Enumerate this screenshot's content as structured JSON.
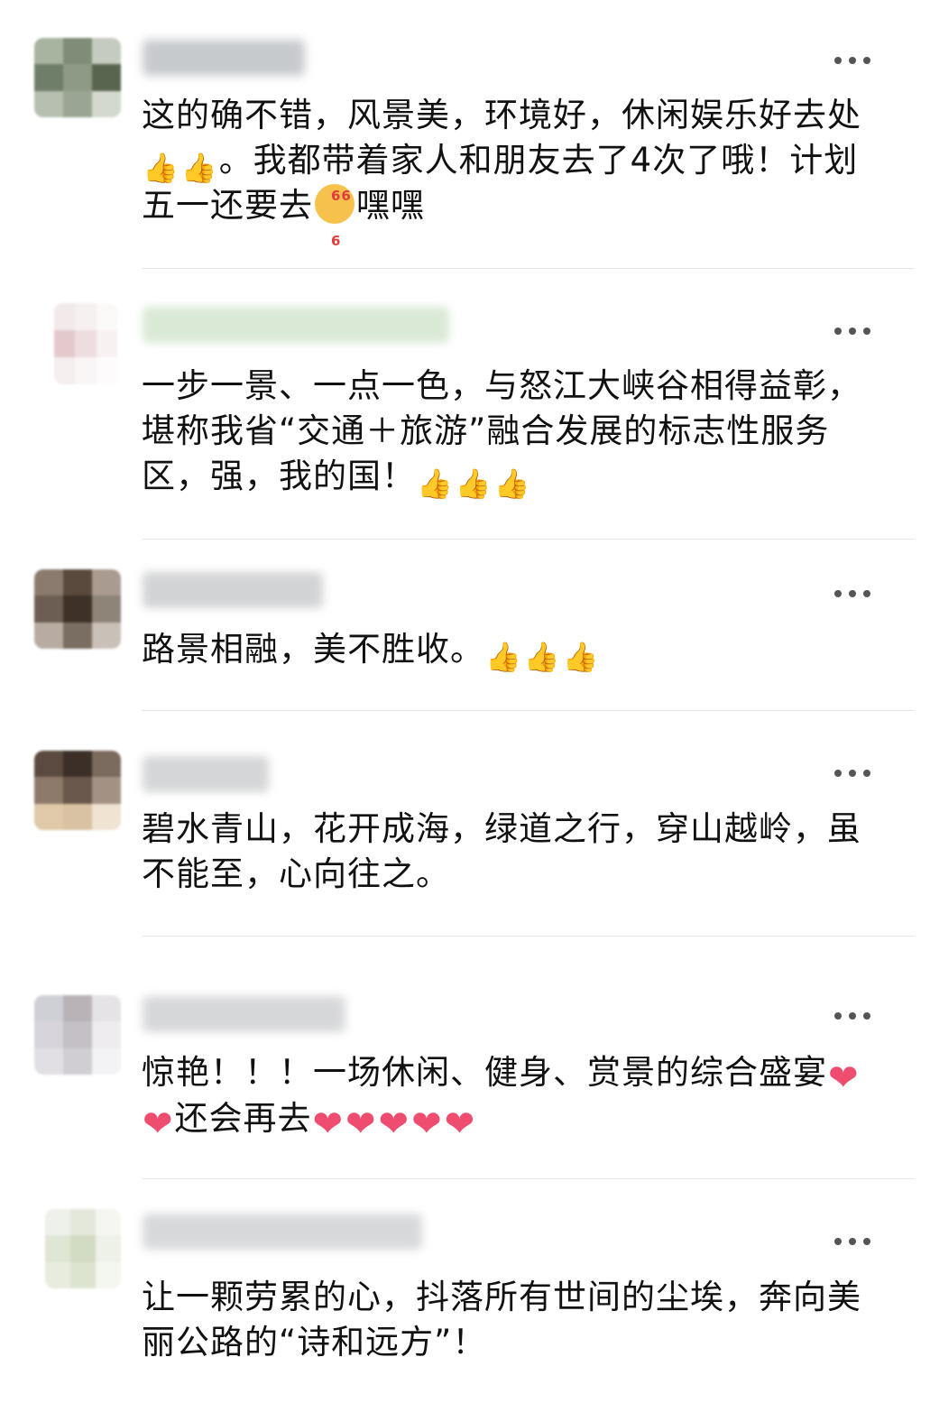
{
  "comments": [
    {
      "text": "这的确不错，风景美，环境好，休闲娱乐好去处",
      "text_b": "。我都带着家人和朋友去了4次了哦！计划五一还要去",
      "text_c": "嘿嘿"
    },
    {
      "text": "一步一景、一点一色，与怒江大峡谷相得益彰，堪称我省“交通＋旅游”融合发展的标志性服务区，强，我的国！"
    },
    {
      "text": "路景相融，美不胜收。"
    },
    {
      "text": "碧水青山，花开成海，绿道之行，穿山越岭，虽不能至，心向往之。"
    },
    {
      "text": "惊艳！！！一场休闲、健身、赏景的综合盛宴",
      "text_b": "还会再去"
    },
    {
      "text": "让一颗劳累的心，抖落所有世间的尘埃，奔向美丽公路的“诗和远方”！"
    }
  ],
  "emoji": {
    "thumbs_up": "👍",
    "heart": "❤",
    "sticker_666": "666"
  },
  "colors": {
    "divider": "#e6e6e6",
    "text": "#111111",
    "more_dots": "#555555",
    "heart": "#ee4d6f"
  },
  "icons": {
    "more": "more-dots-icon"
  }
}
